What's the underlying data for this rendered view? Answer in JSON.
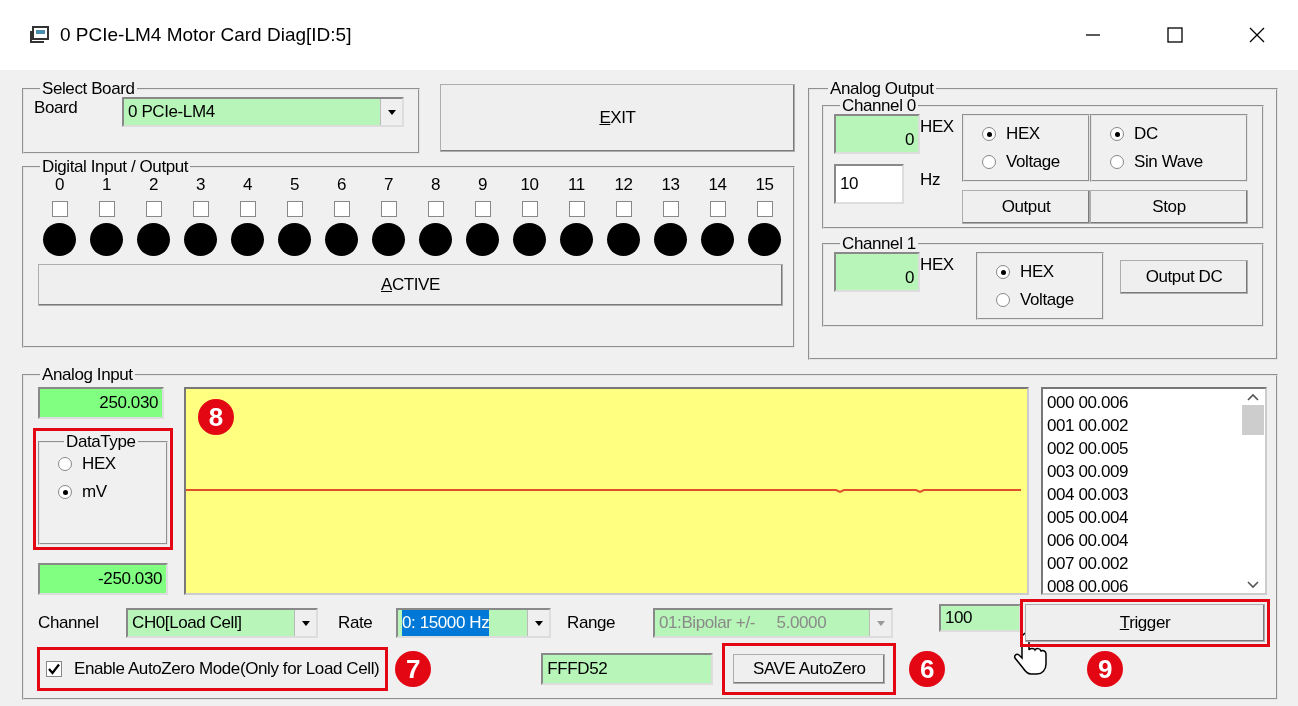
{
  "window": {
    "title": "0 PCIe-LM4  Motor Card Diag[ID:5]"
  },
  "select_board": {
    "title": "Select Board",
    "label": "Board",
    "value": "0 PCIe-LM4"
  },
  "exit_button": "EXIT",
  "digital_io": {
    "title": "Digital Input / Output",
    "bits": [
      {
        "label": "0",
        "checked": false,
        "on": false
      },
      {
        "label": "1",
        "checked": false,
        "on": false
      },
      {
        "label": "2",
        "checked": false,
        "on": false
      },
      {
        "label": "3",
        "checked": false,
        "on": false
      },
      {
        "label": "4",
        "checked": false,
        "on": false
      },
      {
        "label": "5",
        "checked": false,
        "on": false
      },
      {
        "label": "6",
        "checked": false,
        "on": false
      },
      {
        "label": "7",
        "checked": false,
        "on": false
      },
      {
        "label": "8",
        "checked": false,
        "on": false
      },
      {
        "label": "9",
        "checked": false,
        "on": false
      },
      {
        "label": "10",
        "checked": false,
        "on": false
      },
      {
        "label": "11",
        "checked": false,
        "on": false
      },
      {
        "label": "12",
        "checked": false,
        "on": false
      },
      {
        "label": "13",
        "checked": false,
        "on": false
      },
      {
        "label": "14",
        "checked": false,
        "on": false
      },
      {
        "label": "15",
        "checked": false,
        "on": false
      }
    ],
    "active_button": "ACTIVE"
  },
  "analog_output": {
    "title": "Analog Output",
    "channel_0": {
      "title": "Channel 0",
      "value": "0",
      "unit": "HEX",
      "mode_options": [
        {
          "label": "HEX",
          "selected": true
        },
        {
          "label": "Voltage",
          "selected": false
        }
      ],
      "wave_options": [
        {
          "label": "DC",
          "selected": true
        },
        {
          "label": "Sin Wave",
          "selected": false
        }
      ],
      "frequency": "10",
      "frequency_unit": "Hz",
      "buttons": [
        "Output",
        "Stop"
      ]
    },
    "channel_1": {
      "title": "Channel 1",
      "value": "0",
      "unit": "HEX",
      "mode_options": [
        {
          "label": "HEX",
          "selected": true
        },
        {
          "label": "Voltage",
          "selected": false
        }
      ],
      "button": "Output DC"
    }
  },
  "analog_input": {
    "title": "Analog Input",
    "max": "250.030",
    "min": "-250.030",
    "data_type": {
      "title": "DataType",
      "highlighted": true,
      "callout": "8",
      "options": [
        {
          "label": "HEX",
          "selected": false
        },
        {
          "label": "mV",
          "selected": true
        }
      ]
    },
    "readings": [
      "000 00.006",
      "001 00.002",
      "002 00.005",
      "003 00.009",
      "004 00.003",
      "005 00.004",
      "006 00.004",
      "007 00.002",
      "008 00.006"
    ],
    "channel": {
      "label": "Channel",
      "value": "CH0[Load Cell]"
    },
    "rate": {
      "label": "Rate",
      "value": "0: 15000 Hz"
    },
    "range": {
      "label": "Range",
      "value": "01:Bipolar +/-     5.0000",
      "disabled": true
    },
    "count": "100",
    "trigger": {
      "label": "Trigger",
      "highlighted": true,
      "callout": "9"
    },
    "autozero": {
      "label": "Enable AutoZero Mode(Only for Load Cell)",
      "checked": true,
      "highlighted": true,
      "callout": "7"
    },
    "zero_value": "FFFD52",
    "save_button": {
      "label": "SAVE AutoZero",
      "highlighted": true,
      "callout": "6"
    }
  }
}
